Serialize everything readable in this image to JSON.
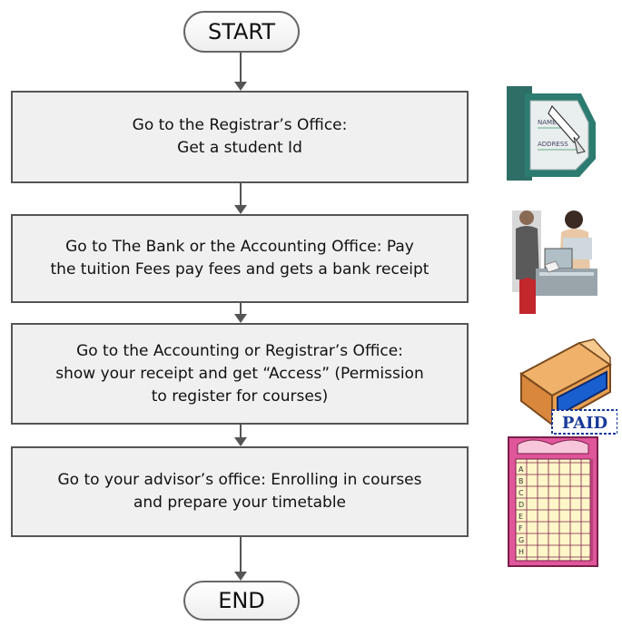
{
  "flow": {
    "start": "START",
    "end": "END",
    "steps": [
      {
        "lines": [
          "Go to the Registrar’s Office:",
          "Get a student Id"
        ]
      },
      {
        "lines": [
          "Go to The Bank or the Accounting Office: Pay",
          "the tuition Fees pay fees and gets a bank receipt"
        ]
      },
      {
        "lines": [
          "Go to the  Accounting or Registrar’s Office:",
          "show your receipt and get “Access” (Permission",
          "to register for courses)"
        ]
      },
      {
        "lines": [
          "Go to your advisor’s office: Enrolling in courses",
          "and prepare your timetable"
        ]
      }
    ]
  },
  "clipart": {
    "id_card": {
      "name_label": "NAME",
      "address_label": "ADDRESS"
    },
    "paid_box": {
      "stamp": "PAID"
    },
    "timetable": {
      "row_letters": [
        "A",
        "B",
        "C",
        "D",
        "E",
        "F",
        "G",
        "H"
      ]
    }
  },
  "colors": {
    "box_fill": "#f0f0f0",
    "box_border": "#555555",
    "id_card_teal": "#2e6e66",
    "paid_blue": "#1a5fd0",
    "timetable_pink": "#e0569a"
  }
}
